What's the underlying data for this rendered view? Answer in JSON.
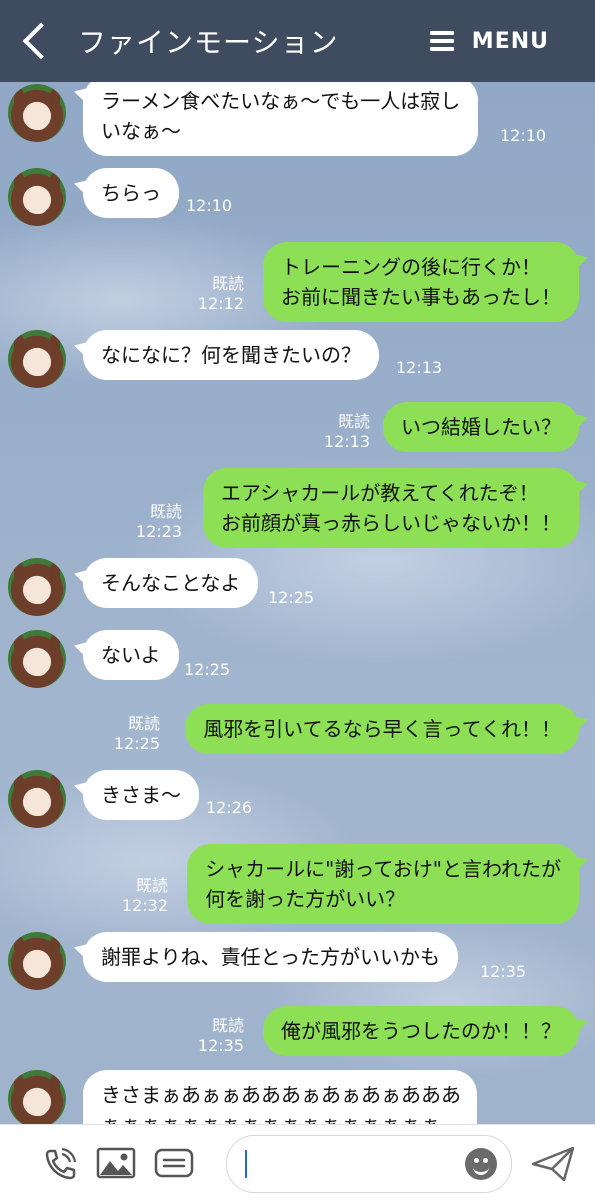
{
  "header": {
    "title": "ファインモーション",
    "menu_label": "MENU"
  },
  "messages": [
    {
      "side": "in",
      "lines": [
        "ラーメン食べたいなぁ～でも一人は寂し",
        "いなぁ～"
      ],
      "time": "12:10"
    },
    {
      "side": "in",
      "lines": [
        "ちらっ"
      ],
      "time": "12:10"
    },
    {
      "side": "out",
      "lines": [
        "トレーニングの後に行くか！",
        "お前に聞きたい事もあったし！"
      ],
      "read": "既読",
      "time": "12:12"
    },
    {
      "side": "in",
      "lines": [
        "なになに？何を聞きたいの？"
      ],
      "time": "12:13"
    },
    {
      "side": "out",
      "lines": [
        "いつ結婚したい？"
      ],
      "read": "既読",
      "time": "12:13"
    },
    {
      "side": "out",
      "lines": [
        "エアシャカールが教えてくれたぞ！",
        "お前顔が真っ赤らしいじゃないか！！"
      ],
      "read": "既読",
      "time": "12:23"
    },
    {
      "side": "in",
      "lines": [
        "そんなことなよ"
      ],
      "time": "12:25"
    },
    {
      "side": "in",
      "lines": [
        "ないよ"
      ],
      "time": "12:25"
    },
    {
      "side": "out",
      "lines": [
        "風邪を引いてるなら早く言ってくれ！！"
      ],
      "read": "既読",
      "time": "12:25"
    },
    {
      "side": "in",
      "lines": [
        "きさま～"
      ],
      "time": "12:26"
    },
    {
      "side": "out",
      "lines": [
        "シャカールに\"謝っておけ\"と言われたが",
        "何を謝った方がいい？"
      ],
      "read": "既読",
      "time": "12:32"
    },
    {
      "side": "in",
      "lines": [
        "謝罪よりね、責任とった方がいいかも"
      ],
      "time": "12:35"
    },
    {
      "side": "out",
      "lines": [
        "俺が風邪をうつしたのか！！？"
      ],
      "read": "既読",
      "time": "12:35"
    },
    {
      "side": "in",
      "lines": [
        "きさまぁあぁぁあああぁあぁあぁあああああぁ",
        "ぁぁぁぁぁぁぁぁぁぁぁぁぁぁぁぁぁ"
      ],
      "time": ""
    }
  ],
  "icons": {
    "back": "back-arrow-icon",
    "menu": "hamburger-icon",
    "call": "phone-icon",
    "image": "image-icon",
    "keyboard": "keyboard-icon",
    "emoji": "emoji-icon",
    "send": "send-icon"
  },
  "colors": {
    "header_bg": "#3f4b5f",
    "incoming_bubble": "#ffffff",
    "outgoing_bubble": "#8de055",
    "accent_caret": "#2b63e0"
  }
}
